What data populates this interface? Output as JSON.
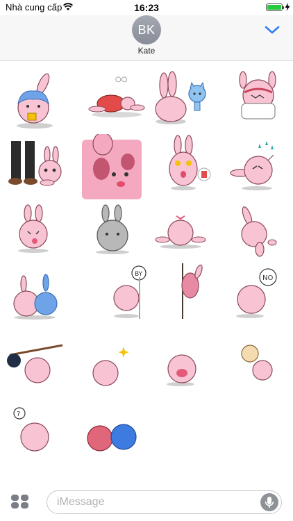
{
  "status_bar": {
    "carrier": "Nhà cung cấp",
    "time": "16:23",
    "battery_level_percent": 100
  },
  "header": {
    "avatar_initials": "BK",
    "contact_name": "Kate",
    "accent_color": "#2f7df6"
  },
  "stickers": [
    {
      "id": 1,
      "body": "#f8c3d2",
      "accent": "#6fa3e8",
      "prop": "none"
    },
    {
      "id": 2,
      "body": "#f8c3d2",
      "accent": "#e34b4b",
      "prop": "zzz"
    },
    {
      "id": 3,
      "body": "#f8c3d2",
      "accent": "#8fc4f0",
      "prop": "blue-cat"
    },
    {
      "id": 4,
      "body": "#f8c3d2",
      "accent": "#c9445a",
      "prop": "pillow"
    },
    {
      "id": 5,
      "body": "#f8c3d2",
      "accent": "#2c2c2c",
      "prop": "legs"
    },
    {
      "id": 6,
      "body": "#f5a9c0",
      "accent": "#c25670",
      "prop": "closeup"
    },
    {
      "id": 7,
      "body": "#f8c3d2",
      "accent": "#f4c20d",
      "prop": "red-envelope"
    },
    {
      "id": 8,
      "body": "#f8c3d2",
      "accent": "#2aa6a0",
      "prop": "sweat"
    },
    {
      "id": 9,
      "body": "#f8c3d2",
      "accent": "#e25b7b",
      "prop": "none"
    },
    {
      "id": 10,
      "body": "#b8b8b8",
      "accent": "#7a7a7a",
      "prop": "stone"
    },
    {
      "id": 11,
      "body": "#f8c3d2",
      "accent": "#e25b7b",
      "prop": "bow"
    },
    {
      "id": 12,
      "body": "#f8c3d2",
      "accent": "#e25b7b",
      "prop": "upside-down"
    },
    {
      "id": 13,
      "body": "#f8c3d2",
      "accent": "#6fa3e8",
      "prop": "blue-friend"
    },
    {
      "id": 14,
      "body": "#f8c3d2",
      "accent": "#e25b7b",
      "prop": "bye-bubble"
    },
    {
      "id": 15,
      "body": "#e88aa3",
      "accent": "#4a3c2c",
      "prop": "peek-door"
    },
    {
      "id": 16,
      "body": "#f8c3d2",
      "accent": "#e25b7b",
      "prop": "no-bubble"
    },
    {
      "id": 17,
      "body": "#f8c3d2",
      "accent": "#1f2e44",
      "prop": "bindle"
    },
    {
      "id": 18,
      "body": "#f8c3d2",
      "accent": "#8a5a2c",
      "prop": "sparkles"
    },
    {
      "id": 19,
      "body": "#f8c3d2",
      "accent": "#e25b7b",
      "prop": "laugh"
    },
    {
      "id": 20,
      "body": "#f8c3d2",
      "accent": "#f4dcb0",
      "prop": "doll"
    },
    {
      "id": 21,
      "body": "#f8c3d2",
      "accent": "#333333",
      "prop": "question-bubble"
    },
    {
      "id": 22,
      "body": "#e0667a",
      "accent": "#3d7be0",
      "prop": "bump-heads"
    }
  ],
  "input_bar": {
    "placeholder": "iMessage"
  }
}
